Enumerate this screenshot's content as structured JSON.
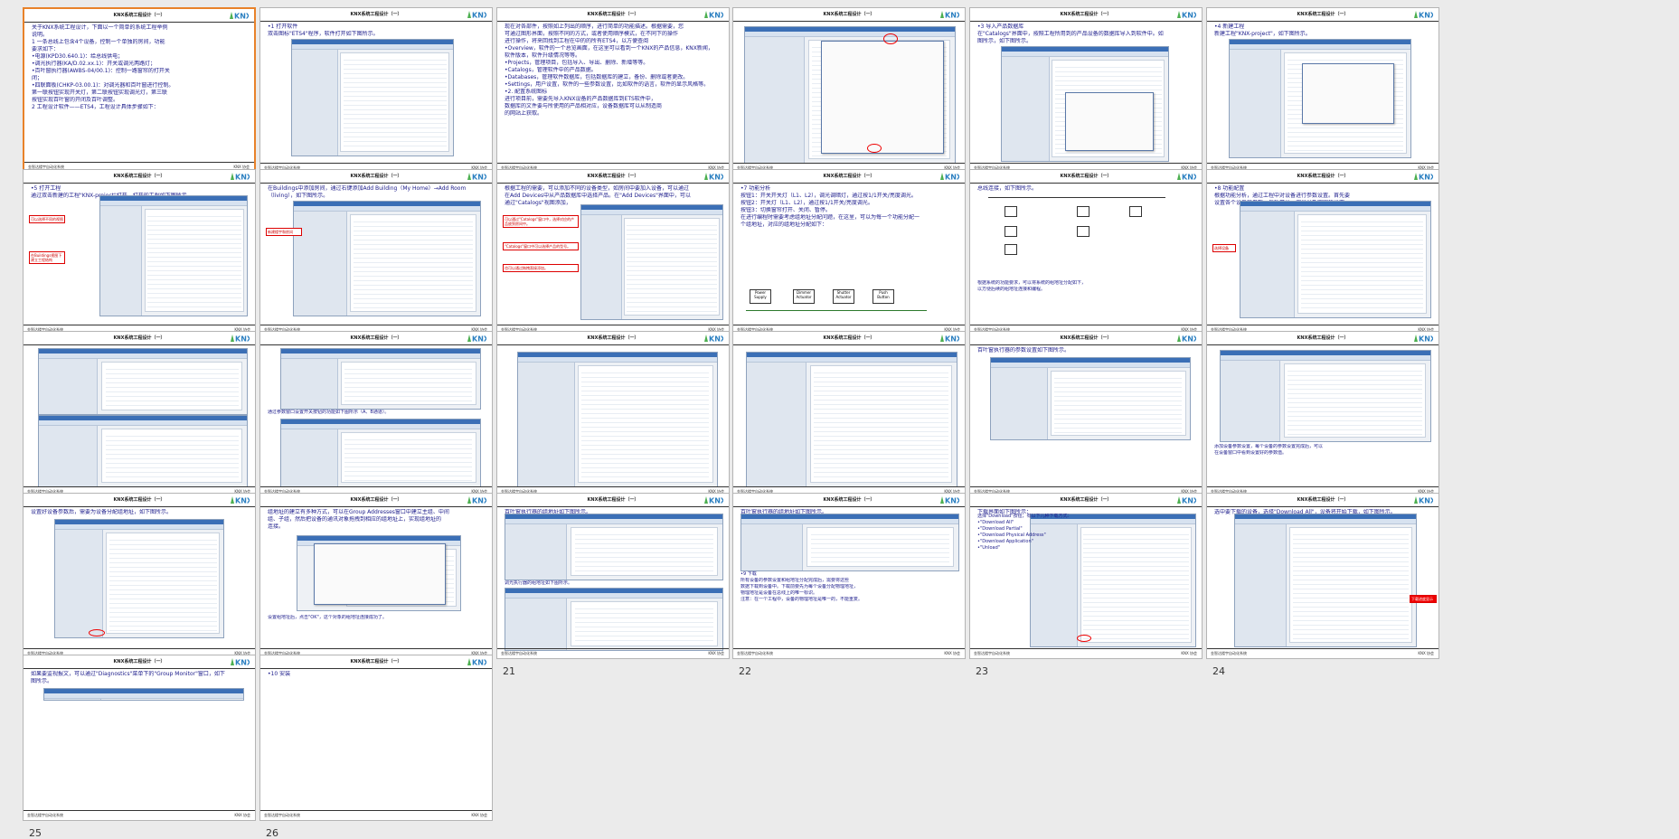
{
  "header": "KNX系统工程设计（一）",
  "footer_left": "金智达楼宇自动化系统",
  "footer_right": "KNX 协会",
  "slides": [
    {
      "num": "1",
      "lines": [
        "关于KNX系统工程设计，下面以一个简单的系统工程举例",
        "说明。",
        "1 一条总线上包含4个设备，控制一个单独的房间，功能",
        "要求如下：",
        "•电源(KPD30.640.1)：给总线供电；",
        "•调光执行器(KA/D.02.xx.1)：开关或调光两路灯；",
        "•百叶窗执行器(AWBS-04/00.1)：控制一路窗帘的打开关",
        "闭；",
        "•四联面板(CHKP-03.00.1)：对调光器和百叶窗进行控制。",
        "第一联按钮实现开关灯，第二联按钮实现调光灯，第三联",
        "按钮实现百叶窗的开闭及百叶调整。",
        "2 工程设计软件——ETS4，工程设计具体步骤如下："
      ]
    },
    {
      "num": "2",
      "lines": [
        "•1 打开软件",
        "双击图标\"ETS4\"程序，软件打开如下图所示。"
      ]
    },
    {
      "num": "3",
      "lines": [
        "现在对各部件，按照如上列出的顺序，进行简单的功能描述。根据需要，您",
        "可通过图形界面，按照不同的方式，或者使用顺序模式，在不同下的操作",
        "进行操作，将来回找到工程在中的的所有ETS4，以方便查阅",
        "•Overview，软件的一个总览画面，在这里可以看到一个KNX的产品信息，KNX新闻，",
        "软件版本，软件升级情况等等。",
        "•Projects，管理项目，包括导入、导出、删除、新增等等。",
        "•Catalogs，管理软件中的产品数据。",
        "•Databases，管理软件数据库，包括数据库的建立，备份、删除或者更改。",
        "•Settings，用户设置，软件的一些参数设置，比如软件的语言，软件的显示风格等。",
        "•2. 配置系统图标",
        "进行项目前，需要先导入KNX设备的产品数据库到ETS软件中，",
        "数据库的文件要与所使用的产品相对应，设备数据库可以从制造商",
        "的网站上获取。"
      ]
    },
    {
      "num": "4",
      "lines": []
    },
    {
      "num": "5",
      "lines": [
        "•3 导入产品数据库",
        "在\"Catalogs\"界面中，按照工程所用到的产品设备的数据库导入到软件中。如",
        "图所示，如下图所示。"
      ]
    },
    {
      "num": "6",
      "lines": [
        "•4 新建工程",
        "新建工程\"KNX-project\"，如下图所示。"
      ]
    },
    {
      "num": "7",
      "lines": [
        "•5 打开工程",
        "通过双击新建的工程\"KNX-project\"打开，打开的工程如下图所示。"
      ],
      "callouts": [
        "可以选择不同的视图",
        "在Buildings视图下建立工程结构"
      ]
    },
    {
      "num": "8",
      "lines": [
        "在Buildings中添加房间，通过右键添加Add Building（My Home）→Add Room",
        "（living），如下图所示。"
      ],
      "callouts": [
        "新建楼宇和房间"
      ]
    },
    {
      "num": "9",
      "lines": [
        "根据工程的需要，可以添加不同的设备类型，如房间中要加入设备，可以通过",
        "在Add Devices中从产品数据库中选择产品。在\"Add Devices\"界面中，可以",
        "通过\"Catalogs\"视图添加，"
      ],
      "callouts": [
        "可以通过\"Catalogs\"窗口中，选择对应的产品放到房间中。",
        "\"Catalogs\"窗口中可以选择产品的型号。",
        "也可以通过拖拽直接添加。"
      ]
    },
    {
      "num": "10",
      "lines": [
        "•7 功能分析",
        "按钮1：开关开关灯（L1、L2），调光调暗灯，通过按1/1开关/亮度调光。",
        "按钮2：开关灯（L1、L2），通过按1/1开关/亮度调光。",
        "按钮3：切换窗帘打开、关闭、暂停。",
        "在进行编程时需要考虑组地址分配问题，在这里，可以为每一个功能分配一",
        "个组地址，对应的组地址分配如下："
      ],
      "legend": [
        "Power Supply",
        "Dimmer Actuator",
        "Shutter Actuator",
        "Push Button"
      ]
    },
    {
      "num": "11",
      "lines": [
        "总线连接，如下图所示。"
      ],
      "notes": [
        "根据系统的功能要求，可以将系统的组地址分配如下，",
        "以方便后续的组地址连接和编程。"
      ]
    },
    {
      "num": "12",
      "lines": [
        "•8 功能配置",
        "根据功能分析，通过工程中对设备进行参数设置。首先要",
        "设置各个设备的参数，包括开关、调光以及窗帘的设置。"
      ],
      "callouts": [
        "选择设备"
      ]
    },
    {
      "num": "13",
      "lines": []
    },
    {
      "num": "14",
      "lines": [],
      "notes": [
        "通过参数窗口设置开关按钮的功能如下图所示（A、B通道）。"
      ]
    },
    {
      "num": "15",
      "lines": []
    },
    {
      "num": "16",
      "lines": []
    },
    {
      "num": "17",
      "lines": [
        "百叶窗执行器的参数设置如下图所示。"
      ]
    },
    {
      "num": "18",
      "lines": [],
      "notes": [
        "添加设备参数设置，每个设备的参数设置完成后，可以",
        "在设备窗口中看到设置好的参数值。"
      ]
    },
    {
      "num": "19",
      "lines": [
        "设置好设备参数后，需要为设备分配组地址，如下图所示。"
      ]
    },
    {
      "num": "20",
      "lines": [
        "组地址的建立有多种方式，可以在Group Addresses窗口中建立主组、中间",
        "组、子组，然后把设备的通讯对象拖拽到相应的组地址上，实现组地址的",
        "连接。"
      ],
      "notes": [
        "设置组地址后，点击\"OK\"，这个对象的组地址连接成功了。"
      ]
    },
    {
      "num": "21",
      "lines": [
        "百叶窗执行器的组地址如下图所示。"
      ],
      "notes": [
        "调光执行器的组地址如下图所示。"
      ]
    },
    {
      "num": "22",
      "lines": [
        "百叶窗执行器的组地址如下图所示。"
      ],
      "notes": [
        "•9 下载",
        "所有设备的参数设置和组地址分配完成后，需要将这些",
        "数据下载到设备中。下载前要先为每个设备分配物理地址，",
        "物理地址是设备在总线上的唯一标识。",
        "注意：在一个工程中，设备的物理地址是唯一的，不能重复。"
      ]
    },
    {
      "num": "23",
      "lines": [
        "下载界面如下图所示："
      ],
      "notes": [
        "选择\"Download\"按钮，有以下几种下载方式：",
        "•\"Download All\"",
        "•\"Download Partial\"",
        "•\"Download Physical Address\"",
        "•\"Download Application\"",
        "•\"Unload\""
      ]
    },
    {
      "num": "24",
      "lines": [
        "选中要下载的设备，选择\"Download All\"，设备将开始下载，如下图所示。"
      ],
      "callouts": [
        "下载进度显示"
      ]
    },
    {
      "num": "25",
      "lines": [
        "如果要监视报文，可以通过\"Diagnostics\"菜单下的\"Group Monitor\"窗口，如下",
        "图所示。"
      ]
    },
    {
      "num": "26",
      "lines": [
        "•10 安装"
      ]
    }
  ]
}
